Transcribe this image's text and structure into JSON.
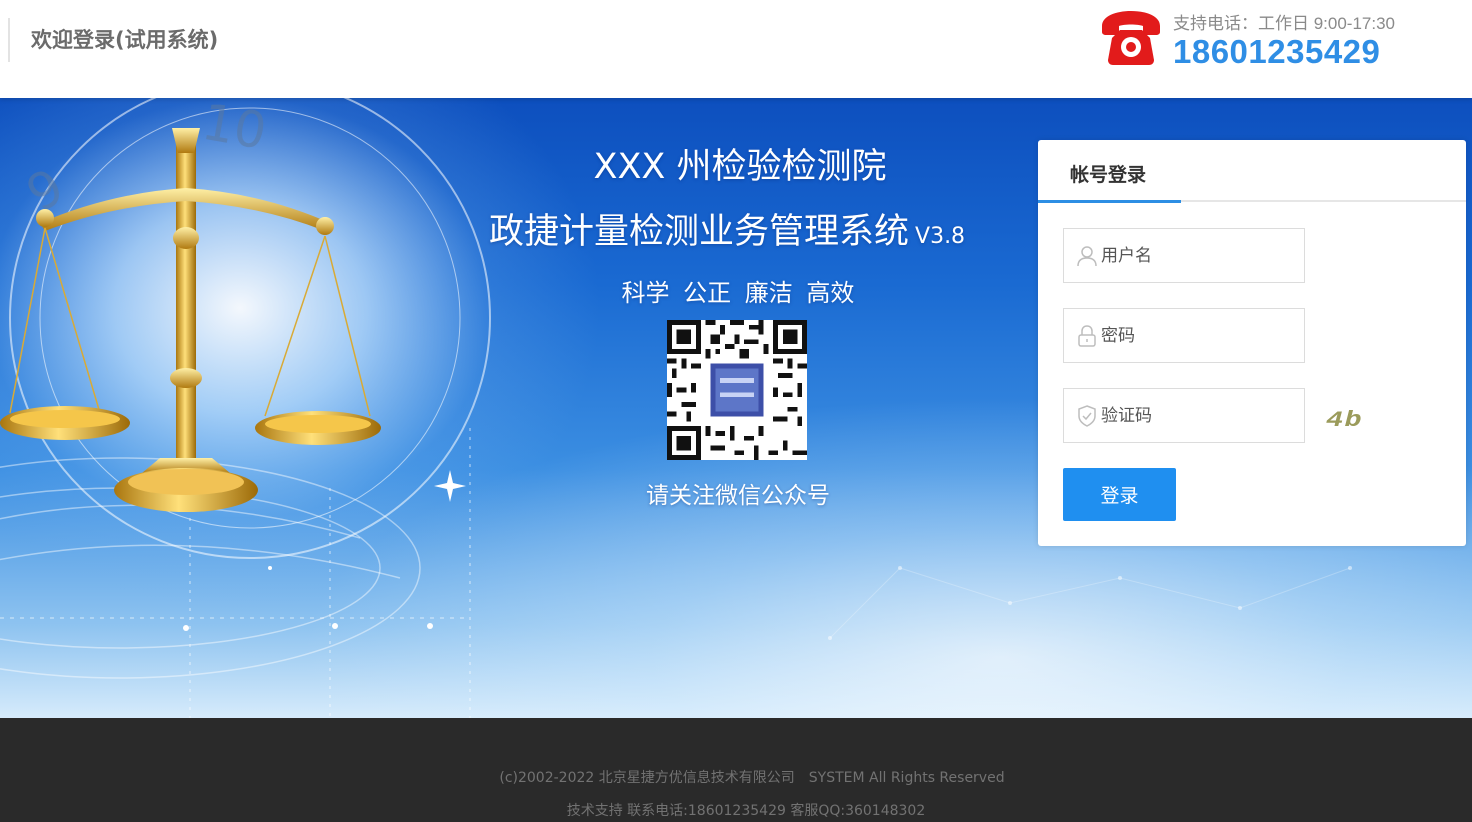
{
  "header": {
    "welcome": "欢迎登录(试用系统)",
    "support_hours": "支持电话：工作日 9:00-17:30",
    "phone": "18601235429"
  },
  "hero": {
    "title_line1": "XXX 州检验检测院",
    "title_line2": "政捷计量检测业务管理系统",
    "version": "V3.8",
    "slogan": "科学 公正 廉洁 高效",
    "qr_caption": "请关注微信公众号"
  },
  "login": {
    "tab_label": "帐号登录",
    "username_placeholder": "用户名",
    "password_placeholder": "密码",
    "captcha_placeholder": "验证码",
    "captcha_text": "4b",
    "submit_label": "登录"
  },
  "footer": {
    "copyright": "(c)2002-2022 北京星捷方优信息技术有限公司",
    "rights": "SYSTEM All Rights Reserved",
    "support": "技术支持 联系电话:18601235429 客服QQ:360148302"
  },
  "colors": {
    "accent": "#1f8ff0",
    "phone_red": "#e21b1b",
    "footer_bg": "#2a2a2a"
  },
  "icons": {
    "phone": "telephone-icon",
    "user": "user-icon",
    "lock": "lock-icon",
    "shield": "shield-check-icon",
    "scale": "balance-scale-icon"
  }
}
